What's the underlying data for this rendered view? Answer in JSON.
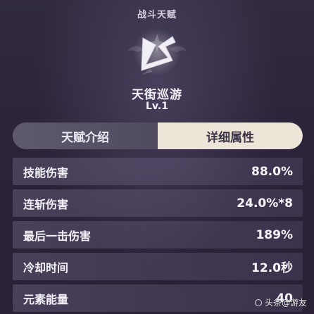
{
  "header": {
    "title": "战斗天赋"
  },
  "talent": {
    "icon": "dash-talent-icon",
    "name": "天街巡游",
    "level": "Lv.1"
  },
  "tabs": [
    {
      "label": "天赋介绍",
      "active": false
    },
    {
      "label": "详细属性",
      "active": true
    }
  ],
  "stats": [
    {
      "label": "技能伤害",
      "value": "88.0%"
    },
    {
      "label": "连斩伤害",
      "value": "24.0%*8"
    },
    {
      "label": "最后一击伤害",
      "value": "189%"
    },
    {
      "label": "冷却时间",
      "value": "12.0秒"
    },
    {
      "label": "元素能量",
      "value": "40"
    }
  ],
  "watermark": {
    "text": "头条@游友"
  },
  "colors": {
    "background": "#2b2339",
    "active_tab": "#ece5d8",
    "inactive_tab": "#5a546a",
    "row_fill": "#6b6383"
  }
}
